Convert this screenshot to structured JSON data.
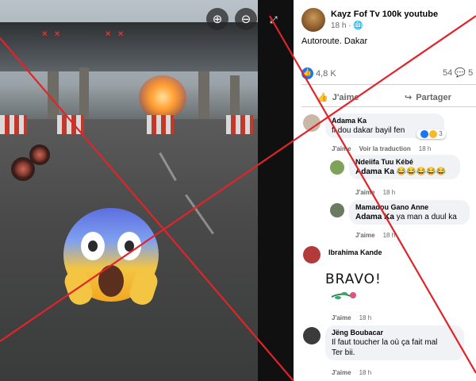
{
  "media": {
    "zoom_in_icon": "zoom-in-icon",
    "zoom_out_icon": "zoom-out-icon",
    "canopy_light_left": "✕ ✕",
    "canopy_light_right": "✕ ✕"
  },
  "post": {
    "author": "Kayz Fof Tv 100k youtube",
    "time": "18 h",
    "caption": "Autoroute. Dakar",
    "reaction_count": "4,8 K",
    "comment_count": "54",
    "share_count_partial": "5",
    "like_label": "J'aime",
    "share_label": "Partager"
  },
  "comments": [
    {
      "name": "Adama Ka",
      "text": "fi dou dakar bayil fen",
      "react_count": "3",
      "like": "J'aime",
      "translate": "Voir la traduction",
      "time": "18 h"
    },
    {
      "name": "Ndeiifa Tuu Kébé",
      "mention": "Adama Ka",
      "emojis": "😂😂😂😂😂",
      "like": "J'aime",
      "time": "18 h"
    },
    {
      "name": "Mamadou Gano Anne",
      "mention": "Adama Ka",
      "text": "ya man a duul ka",
      "like": "J'aime",
      "time": "18 h"
    },
    {
      "name": "Ibrahima Kande",
      "sticker_text": "BRAVO!",
      "like": "J'aime",
      "time": "18 h"
    },
    {
      "name": "Jëng Boubacar",
      "text_line1": "Il faut toucher la où ça fait mal",
      "text_line2": "Ter bii.",
      "like": "J'aime",
      "time": "18 h"
    }
  ],
  "colors": {
    "cross": "#e0242a",
    "facebook_blue": "#1877f2",
    "bubble_bg": "#f0f2f5",
    "meta_gray": "#65676b"
  }
}
